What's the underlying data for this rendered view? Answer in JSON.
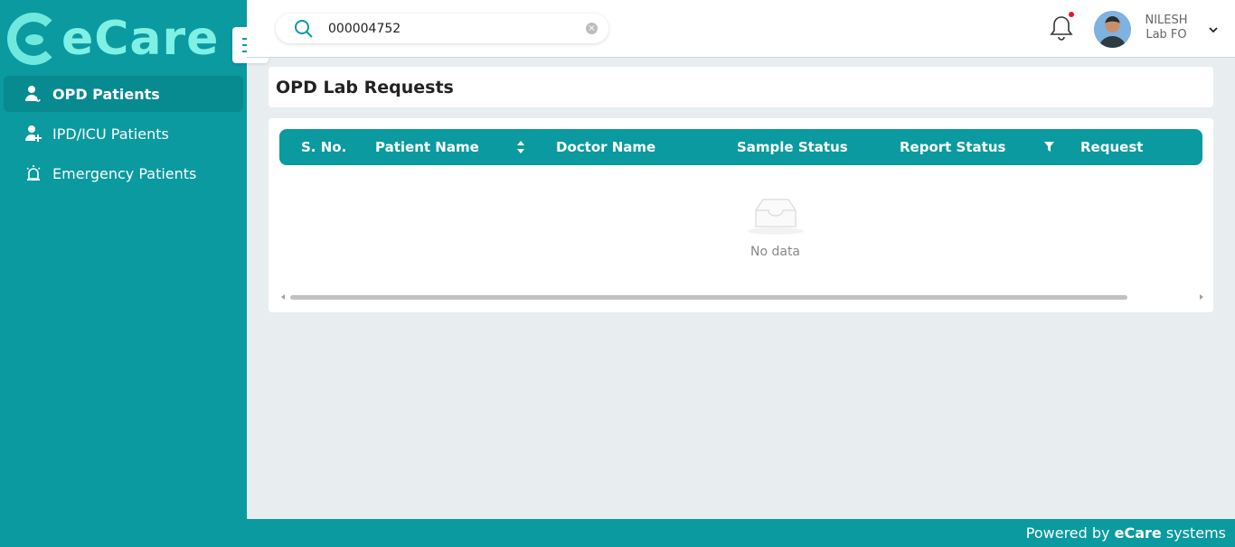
{
  "brand": {
    "logo_text": "eCare",
    "accent": "#0a9aa0"
  },
  "sidebar": {
    "items": [
      {
        "label": "OPD Patients",
        "icon": "user-stethoscope-icon",
        "active": true
      },
      {
        "label": "IPD/ICU Patients",
        "icon": "user-plus-icon",
        "active": false
      },
      {
        "label": "Emergency Patients",
        "icon": "siren-icon",
        "active": false
      }
    ]
  },
  "header": {
    "search_value": "000004752",
    "user": {
      "name": "NILESH",
      "role": "Lab FO"
    }
  },
  "main": {
    "title": "OPD Lab Requests",
    "table": {
      "columns": [
        "S. No.",
        "Patient Name",
        "Doctor Name",
        "Sample Status",
        "Report Status",
        "Request"
      ],
      "rows": [],
      "empty_text": "No data"
    }
  },
  "footer": {
    "prefix": "Powered by ",
    "brand": "eCare",
    "suffix": " systems"
  }
}
